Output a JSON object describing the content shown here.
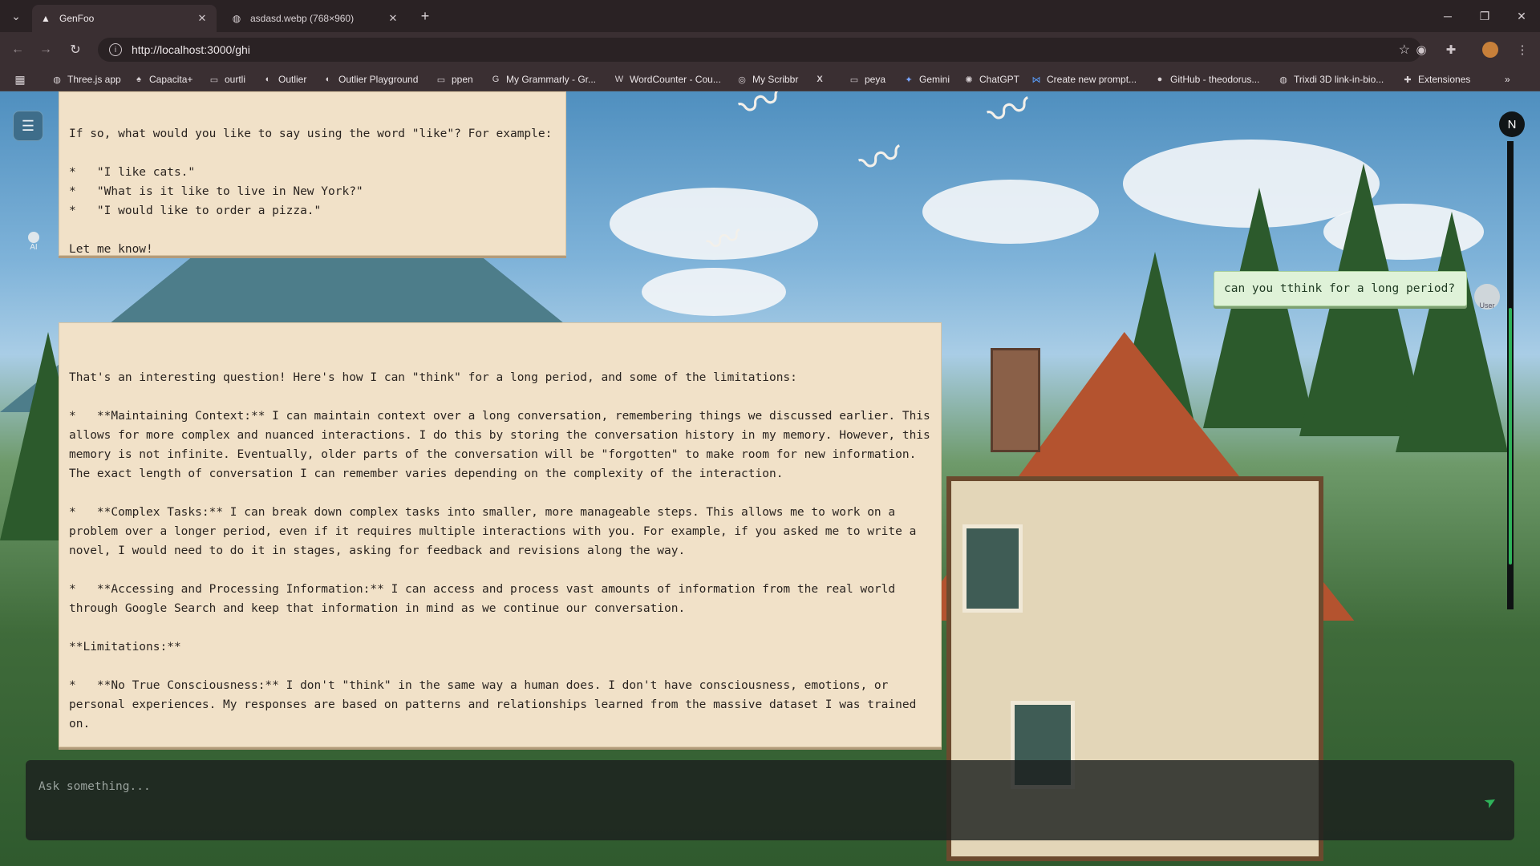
{
  "browser": {
    "tabs": [
      {
        "title": "GenFoo",
        "icon": "genfoo-favicon"
      },
      {
        "title": "asdasd.webp (768×960)",
        "icon": "globe-icon"
      }
    ],
    "url": "http://localhost:3000/ghi",
    "bookmarks": [
      {
        "label": "Three.js app",
        "icon": "globe-icon"
      },
      {
        "label": "Capacita+",
        "icon": "capacita-icon"
      },
      {
        "label": "ourtli",
        "icon": "folder-icon"
      },
      {
        "label": "Outlier",
        "icon": "outlier-icon"
      },
      {
        "label": "Outlier Playground",
        "icon": "outlier-icon"
      },
      {
        "label": "ppen",
        "icon": "folder-icon"
      },
      {
        "label": "My Grammarly - Gr...",
        "icon": "grammarly-icon"
      },
      {
        "label": "WordCounter - Cou...",
        "icon": "w-icon"
      },
      {
        "label": "My Scribbr",
        "icon": "scribbr-icon"
      },
      {
        "label": "",
        "icon": "x-logo-icon"
      },
      {
        "label": "peya",
        "icon": "folder-icon"
      },
      {
        "label": "Gemini",
        "icon": "gemini-icon"
      },
      {
        "label": "ChatGPT",
        "icon": "chatgpt-icon"
      },
      {
        "label": "Create new prompt...",
        "icon": "butterfly-icon"
      },
      {
        "label": "GitHub - theodorus...",
        "icon": "github-icon"
      },
      {
        "label": "Trixdi 3D link-in-bio...",
        "icon": "globe-icon"
      },
      {
        "label": "Extensiones",
        "icon": "puzzle-icon"
      }
    ]
  },
  "chat": {
    "ai_avatar_label": "AI",
    "messages": [
      {
        "role": "assistant",
        "text": "If so, what would you like to say using the word \"like\"? For example:\n\n*   \"I like cats.\"\n*   \"What is it like to live in New York?\"\n*   \"I would like to order a pizza.\"\n\nLet me know!"
      },
      {
        "role": "user",
        "text": "can you tthink for a long period?"
      },
      {
        "role": "assistant",
        "text": "That's an interesting question! Here's how I can \"think\" for a long period, and some of the limitations:\n\n*   **Maintaining Context:** I can maintain context over a long conversation, remembering things we discussed earlier. This allows for more complex and nuanced interactions. I do this by storing the conversation history in my memory. However, this memory is not infinite. Eventually, older parts of the conversation will be \"forgotten\" to make room for new information. The exact length of conversation I can remember varies depending on the complexity of the interaction.\n\n*   **Complex Tasks:** I can break down complex tasks into smaller, more manageable steps. This allows me to work on a problem over a longer period, even if it requires multiple interactions with you. For example, if you asked me to write a novel, I would need to do it in stages, asking for feedback and revisions along the way.\n\n*   **Accessing and Processing Information:** I can access and process vast amounts of information from the real world through Google Search and keep that information in mind as we continue our conversation.\n\n**Limitations:**\n\n*   **No True Consciousness:** I don't \"think\" in the same way a human does. I don't have consciousness, emotions, or personal experiences. My responses are based on patterns and relationships learned from the massive dataset I was trained on.\n\n*   **Memory Limits:** As mentioned earlier, my memory of past conversations is limited."
      }
    ],
    "user_avatar_label": "User",
    "account_initial": "N"
  },
  "composer": {
    "placeholder": "Ask something..."
  },
  "colors": {
    "bubble_ai": "#f1e1c8",
    "bubble_user": "#dff2d8",
    "accent": "#2fb35a"
  }
}
